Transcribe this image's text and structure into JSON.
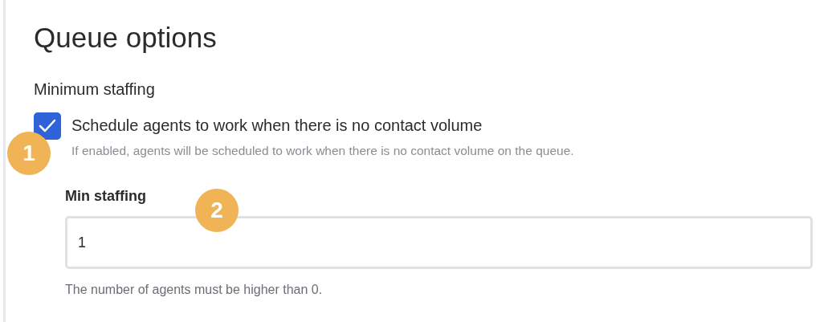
{
  "title": "Queue options",
  "section": {
    "heading": "Minimum staffing",
    "checkbox": {
      "label": "Schedule agents to work when there is no contact volume",
      "checked": true,
      "description": "If enabled, agents will be scheduled to work when there is no contact volume on the queue."
    },
    "field": {
      "label": "Min staffing",
      "value": "1",
      "help": "The number of agents must be higher than 0."
    }
  },
  "callouts": [
    {
      "label": "1"
    },
    {
      "label": "2"
    }
  ]
}
